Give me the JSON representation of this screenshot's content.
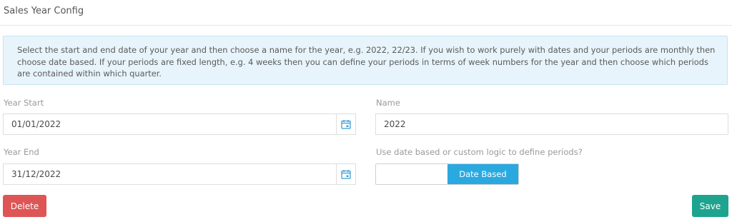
{
  "header": {
    "title": "Sales Year Config"
  },
  "info": {
    "text": "Select the start and end date of your year and then choose a name for the year, e.g. 2022, 22/23. If you wish to work purely with dates and your periods are monthly then choose date based. If your periods are fixed length, e.g. 4 weeks then you can define your periods in terms of week numbers for the year and then choose which periods are contained within which quarter."
  },
  "form": {
    "year_start": {
      "label": "Year Start",
      "value": "01/01/2022"
    },
    "year_end": {
      "label": "Year End",
      "value": "31/12/2022"
    },
    "name": {
      "label": "Name",
      "value": "2022"
    },
    "period_mode": {
      "label": "Use date based or custom logic to define periods?",
      "selected": "Date Based"
    }
  },
  "actions": {
    "delete_label": "Delete",
    "save_label": "Save"
  },
  "icons": {
    "calendar": "calendar-icon"
  },
  "colors": {
    "info_bg": "#e8f4fb",
    "info_border": "#c6e3f3",
    "toggle_on": "#2aa9e0",
    "delete": "#dd5555",
    "save": "#1ea48e",
    "calendar_icon": "#3b9fd6"
  }
}
